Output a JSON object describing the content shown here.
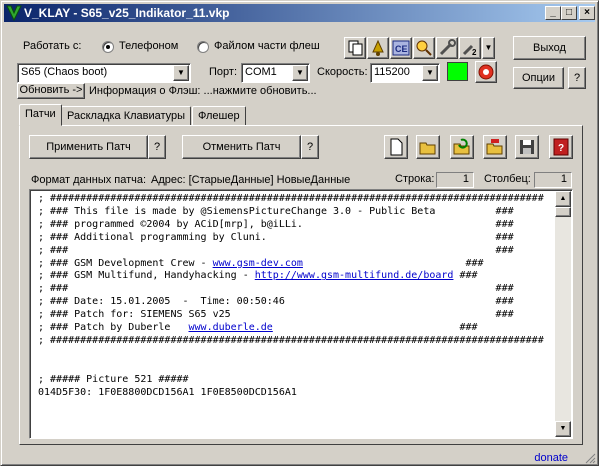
{
  "window": {
    "title": "V_KLAY - S65_v25_Indikator_11.vkp"
  },
  "top": {
    "work_with_label": "Работать с:",
    "radio_phone": "Телефоном",
    "radio_flash_file": "Файлом части флеш",
    "exit_button": "Выход",
    "options_button": "Опции",
    "help_button": "?",
    "model_combo": "S65 (Chaos boot)",
    "port_label": "Порт:",
    "port_combo": "COM1",
    "speed_label": "Скорость:",
    "speed_combo": "115200",
    "refresh_button": "Обновить ->",
    "flash_info": "Информация о Флэш: ...нажмите обновить...",
    "status_color": "#00ff00"
  },
  "tabs": [
    {
      "label": "Патчи",
      "active": true
    },
    {
      "label": "Раскладка Клавиатуры",
      "active": false
    },
    {
      "label": "Флешер",
      "active": false
    }
  ],
  "patch": {
    "apply_button": "Применить Патч",
    "apply_help": "?",
    "cancel_button": "Отменить Патч",
    "cancel_help": "?",
    "format_label": "Формат данных патча:",
    "format_value": "Адрес: [СтарыеДанные] НовыеДанные",
    "row_label": "Строка:",
    "row_value": "1",
    "col_label": "Столбец:",
    "col_value": "1"
  },
  "code_lines": [
    {
      "pre": "; ##################################################################################",
      "link": "",
      "post": ""
    },
    {
      "pre": "; ### This file is made by @SiemensPictureChange 3.0 - Public Beta          ###",
      "link": "",
      "post": ""
    },
    {
      "pre": "; ### programmed ©2004 by ACiD[mrp], b@iLLi.                                ###",
      "link": "",
      "post": ""
    },
    {
      "pre": "; ### Additional programming by Cluni.                                      ###",
      "link": "",
      "post": ""
    },
    {
      "pre": "; ###                                                                       ###",
      "link": "",
      "post": ""
    },
    {
      "pre": "; ### GSM Development Crew - ",
      "link": "www.gsm-dev.com",
      "post": "                           ###"
    },
    {
      "pre": "; ### GSM Multifund, Handyhacking - ",
      "link": "http://www.gsm-multifund.de/board",
      "post": " ###"
    },
    {
      "pre": "; ###                                                                       ###",
      "link": "",
      "post": ""
    },
    {
      "pre": "; ### Date: 15.01.2005  -  Time: 00:50:46                                   ###",
      "link": "",
      "post": ""
    },
    {
      "pre": "; ### Patch for: SIEMENS S65 v25                                            ###",
      "link": "",
      "post": ""
    },
    {
      "pre": "; ### Patch by Duberle   ",
      "link": "www.duberle.de",
      "post": "                               ###"
    },
    {
      "pre": "; ##################################################################################",
      "link": "",
      "post": ""
    },
    {
      "pre": "",
      "link": "",
      "post": ""
    },
    {
      "pre": "",
      "link": "",
      "post": ""
    },
    {
      "pre": "; ##### Picture 521 #####",
      "link": "",
      "post": ""
    },
    {
      "pre": "014D5F30: 1F0E8800DCD156A1 1F0E8500DCD156A1",
      "link": "",
      "post": ""
    }
  ],
  "footer": {
    "donate": "donate"
  }
}
